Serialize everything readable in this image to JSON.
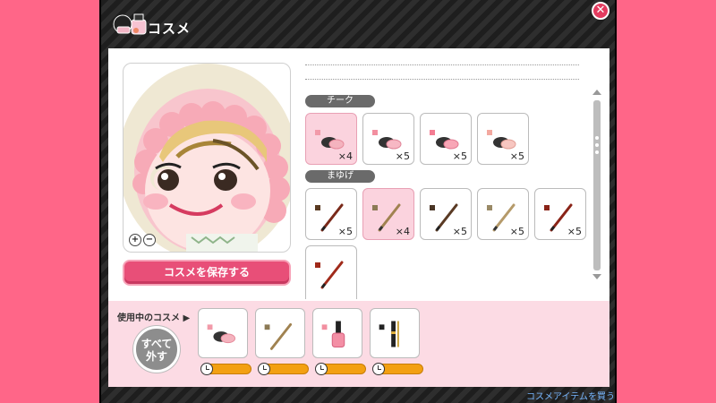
{
  "header": {
    "title": "コスメ",
    "close_symbol": "✕"
  },
  "zoom": {
    "in": "+",
    "out": "−"
  },
  "save_button": "コスメを保存する",
  "sections": {
    "cheek": {
      "label": "チーク",
      "counts": [
        "×4",
        "×5",
        "×5",
        "×5"
      ]
    },
    "eyebrow": {
      "label": "まゆげ",
      "counts": [
        "×5",
        "×4",
        "×5",
        "×5",
        "×5"
      ]
    }
  },
  "bottom": {
    "using_label": "使用中のコスメ",
    "remove_all": "すべて\n外す",
    "buy_link": "コスメアイテムを買う"
  },
  "colors": {
    "background": "#ff6688",
    "accent": "#e84f78",
    "selected": "#fbd3de",
    "timer": "#f3a012"
  }
}
